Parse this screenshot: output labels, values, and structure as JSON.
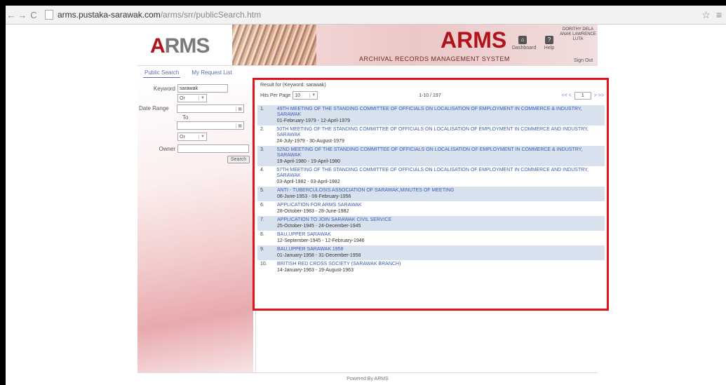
{
  "browser": {
    "url_host": "arms.pustaka-sarawak.com",
    "url_path": "/arms/srr/publicSearch.htm",
    "back": "←",
    "forward": "→",
    "reload": "C",
    "star": "☆",
    "menu": "≡"
  },
  "header": {
    "logo_a": "A",
    "logo_rest": "RMS",
    "title": "ARMS",
    "subtitle": "ARCHIVAL RECORDS MANAGEMENT SYSTEM",
    "dashboard": "Dashboard",
    "help": "Help",
    "user_name": "DORITHY DELA ANAK LAWRENCE LUTA",
    "sign_out": "Sign Out"
  },
  "tabs": {
    "public_search": "Public Search",
    "my_request_list": "My Request List"
  },
  "search": {
    "keyword_label": "Keyword",
    "keyword_value": "sarawak",
    "or1": "Or",
    "date_range_label": "Date Range",
    "to_label": "To",
    "or2": "Or",
    "owner_label": "Owner",
    "search_button": "Search"
  },
  "results": {
    "header": "Result for (Keyword: sarawak)",
    "hits_label": "Hits Per Page",
    "hits_value": "10",
    "range": "1-10 / 197",
    "first_prev": "<< <",
    "page": "1",
    "next_last": "> >>",
    "items": [
      {
        "num": "1.",
        "title": "49TH MEETING OF THE STANDING COMMITTEE OF OFFICIALS ON LOCALISATION OF EMPLOYMENT IN COMMERCE & INDUSTRY, SARAWAK",
        "date": "01-February-1979 - 12-April-1979"
      },
      {
        "num": "2.",
        "title": "50TH MEETING OF THE STANDING COMMITTEE OF OFFICIALS ON LOCALISATION OF EMPLOYMENT IN COMMERCE AND INDUSTRY, SARAWAK",
        "date": "24-July-1979 - 30-August-1979"
      },
      {
        "num": "3.",
        "title": "52ND MEETING OF THE STANDING COMMITTEE OF OFFICIALS ON LOCALISATION OF EMPLOYMENT IN COMMERCE & INDUSTRY, SARAWAK",
        "date": "19-April-1980 - 19-April-1980"
      },
      {
        "num": "4.",
        "title": "57TH MEETING OF THE STANDING COMMITTEE OF OFFICIALS ON LOCALISATION OF EMPLOYMENT IN COMMERCE AND INDUSTRY, SARAWAK",
        "date": "03-April-1982 - 03-April-1982"
      },
      {
        "num": "5.",
        "title": "ANTI - TUBERCULOSIS ASSOCIATION OF SARAWAK,MINUTES OF MEETING",
        "date": "06-June-1953 - 06-February-1956"
      },
      {
        "num": "6.",
        "title": "APPLICATION FOR ARMS SARAWAK",
        "date": "28-October-1983 - 28-June-1982"
      },
      {
        "num": "7.",
        "title": "APPLICATION TO JOIN SARAWAK CIVIL SERVICE",
        "date": "25-October-1945 - 24-December-1945"
      },
      {
        "num": "8.",
        "title": "BAU,UPPER SARAWAK",
        "date": "12-September-1945 - 12-February-1946"
      },
      {
        "num": "9.",
        "title": "BAU,UPPER SARAWAK 1958",
        "date": "01-January-1958 - 31-December-1958"
      },
      {
        "num": "10.",
        "title": "BRITISH RED CROSS SOCIETY (SARAWAK BRANCH)",
        "date": "14-January-1963 - 19-August-1963"
      }
    ]
  },
  "footer": {
    "text": "Powered By ARMS"
  },
  "colors": {
    "accent": "#e0141a",
    "brand": "#b0131a",
    "link": "#3d5db8",
    "row": "#d8e1ee"
  }
}
